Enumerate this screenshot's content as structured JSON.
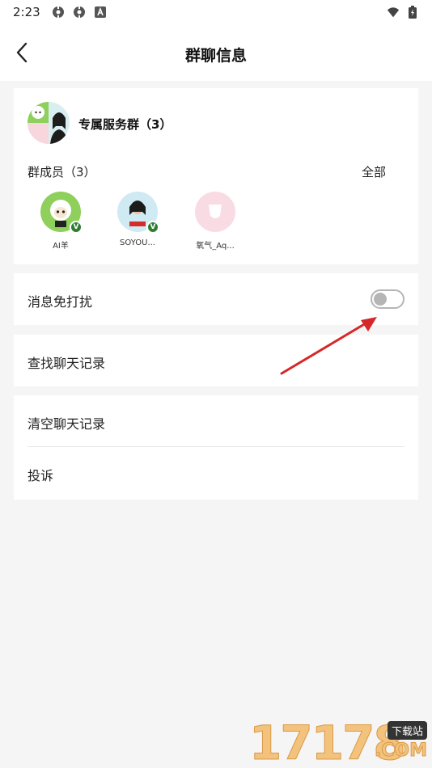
{
  "status_bar": {
    "time": "2:23",
    "icons_left": [
      "settings-gear-icon",
      "settings-gear-icon",
      "a-badge-icon"
    ],
    "icons_right": [
      "wifi-icon",
      "battery-icon"
    ]
  },
  "header": {
    "back_icon": "chevron-left-icon",
    "title": "群聊信息"
  },
  "group": {
    "name": "专属服务群（3）",
    "members_title": "群成员（3）",
    "all_label": "全部",
    "members": [
      {
        "name": "AI羊",
        "avatar_color": "#8fcf5c",
        "verified": true
      },
      {
        "name": "SOYOU...",
        "avatar_color": "#cfeaf2",
        "verified": true
      },
      {
        "name": "氧气_Aq...",
        "avatar_color": "#f9dbe3",
        "verified": false
      }
    ]
  },
  "settings": {
    "mute_label": "消息免打扰",
    "mute_enabled": false,
    "search_history_label": "查找聊天记录",
    "clear_history_label": "清空聊天记录",
    "report_label": "投诉"
  },
  "annotation": {
    "arrow_color": "#d62828"
  },
  "watermark": {
    "digits": "17178",
    "tag": "下载站",
    "domain": ".COM"
  },
  "colors": {
    "page_bg": "#f5f5f5",
    "card_bg": "#ffffff",
    "toggle_off": "#b5b5b5",
    "verify_green": "#2e7d32"
  }
}
